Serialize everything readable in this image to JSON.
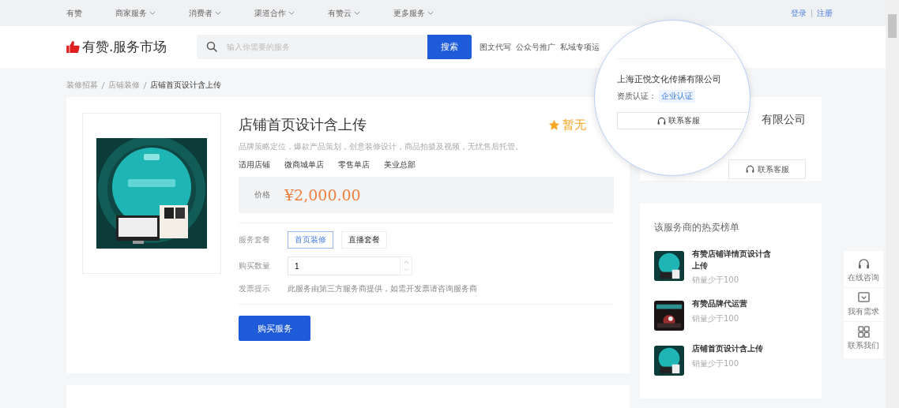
{
  "top_nav": {
    "items": [
      {
        "label": "有赞",
        "has_menu": false
      },
      {
        "label": "商家服务",
        "has_menu": true
      },
      {
        "label": "消费者",
        "has_menu": true
      },
      {
        "label": "渠道合作",
        "has_menu": true
      },
      {
        "label": "有赞云",
        "has_menu": true
      },
      {
        "label": "更多服务",
        "has_menu": true
      }
    ],
    "login": "登录",
    "register": "注册"
  },
  "header": {
    "logo": "有赞.服务市场",
    "search": {
      "placeholder": "输入你需要的服务",
      "button": "搜索"
    },
    "hot_tags": [
      "图文代写",
      "公众号推广",
      "私域专项运"
    ]
  },
  "breadcrumb": [
    "装修招募",
    "店铺装修",
    "店铺首页设计含上传"
  ],
  "product": {
    "title": "店铺首页设计含上传",
    "rating": "暂无",
    "description": "品牌策略定位，爆款产品策划，创意装修设计，商品拍摄及视频，无忧售后托管。",
    "stores_label": "适用店铺",
    "stores": [
      "微商城单店",
      "零售单店",
      "美业总部"
    ],
    "price_label": "价格",
    "price": "¥2,000.00",
    "package_label": "服务套餐",
    "packages": [
      {
        "label": "首页装修",
        "selected": true
      },
      {
        "label": "直播套餐",
        "selected": false
      }
    ],
    "quantity_label": "购买数量",
    "quantity": "1",
    "invoice_label": "发票提示",
    "invoice": "此服务由第三方服务商提供，如需开发票请咨询服务商",
    "buy_button": "购买服务"
  },
  "seller_card": {
    "name": "有限公司",
    "contact_button": "联系客服"
  },
  "magnifier": {
    "company": "上海正悦文化传播有限公司",
    "cert_label": "资质认证：",
    "cert_badge": "企业认证",
    "contact_button": "联系客服"
  },
  "hot_list": {
    "title": "该服务商的热卖榜单",
    "items": [
      {
        "name": "有赞店铺详情页设计含上传",
        "sales": "销量少于100"
      },
      {
        "name": "有赞品牌代运营",
        "sales": "销量少于100"
      },
      {
        "name": "店铺首页设计含上传",
        "sales": "销量少于100"
      }
    ]
  },
  "float_panel": [
    {
      "label": "在线咨询",
      "kind": "headset"
    },
    {
      "label": "我有需求",
      "kind": "message"
    },
    {
      "label": "联系我们",
      "kind": "grid"
    }
  ]
}
